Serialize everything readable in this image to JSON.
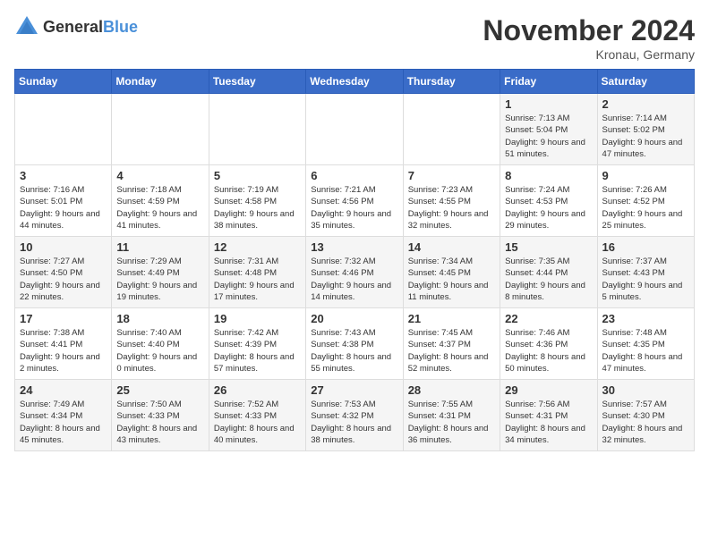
{
  "header": {
    "logo_general": "General",
    "logo_blue": "Blue",
    "month_title": "November 2024",
    "location": "Kronau, Germany"
  },
  "days_of_week": [
    "Sunday",
    "Monday",
    "Tuesday",
    "Wednesday",
    "Thursday",
    "Friday",
    "Saturday"
  ],
  "weeks": [
    [
      {
        "day": "",
        "info": ""
      },
      {
        "day": "",
        "info": ""
      },
      {
        "day": "",
        "info": ""
      },
      {
        "day": "",
        "info": ""
      },
      {
        "day": "",
        "info": ""
      },
      {
        "day": "1",
        "info": "Sunrise: 7:13 AM\nSunset: 5:04 PM\nDaylight: 9 hours and 51 minutes."
      },
      {
        "day": "2",
        "info": "Sunrise: 7:14 AM\nSunset: 5:02 PM\nDaylight: 9 hours and 47 minutes."
      }
    ],
    [
      {
        "day": "3",
        "info": "Sunrise: 7:16 AM\nSunset: 5:01 PM\nDaylight: 9 hours and 44 minutes."
      },
      {
        "day": "4",
        "info": "Sunrise: 7:18 AM\nSunset: 4:59 PM\nDaylight: 9 hours and 41 minutes."
      },
      {
        "day": "5",
        "info": "Sunrise: 7:19 AM\nSunset: 4:58 PM\nDaylight: 9 hours and 38 minutes."
      },
      {
        "day": "6",
        "info": "Sunrise: 7:21 AM\nSunset: 4:56 PM\nDaylight: 9 hours and 35 minutes."
      },
      {
        "day": "7",
        "info": "Sunrise: 7:23 AM\nSunset: 4:55 PM\nDaylight: 9 hours and 32 minutes."
      },
      {
        "day": "8",
        "info": "Sunrise: 7:24 AM\nSunset: 4:53 PM\nDaylight: 9 hours and 29 minutes."
      },
      {
        "day": "9",
        "info": "Sunrise: 7:26 AM\nSunset: 4:52 PM\nDaylight: 9 hours and 25 minutes."
      }
    ],
    [
      {
        "day": "10",
        "info": "Sunrise: 7:27 AM\nSunset: 4:50 PM\nDaylight: 9 hours and 22 minutes."
      },
      {
        "day": "11",
        "info": "Sunrise: 7:29 AM\nSunset: 4:49 PM\nDaylight: 9 hours and 19 minutes."
      },
      {
        "day": "12",
        "info": "Sunrise: 7:31 AM\nSunset: 4:48 PM\nDaylight: 9 hours and 17 minutes."
      },
      {
        "day": "13",
        "info": "Sunrise: 7:32 AM\nSunset: 4:46 PM\nDaylight: 9 hours and 14 minutes."
      },
      {
        "day": "14",
        "info": "Sunrise: 7:34 AM\nSunset: 4:45 PM\nDaylight: 9 hours and 11 minutes."
      },
      {
        "day": "15",
        "info": "Sunrise: 7:35 AM\nSunset: 4:44 PM\nDaylight: 9 hours and 8 minutes."
      },
      {
        "day": "16",
        "info": "Sunrise: 7:37 AM\nSunset: 4:43 PM\nDaylight: 9 hours and 5 minutes."
      }
    ],
    [
      {
        "day": "17",
        "info": "Sunrise: 7:38 AM\nSunset: 4:41 PM\nDaylight: 9 hours and 2 minutes."
      },
      {
        "day": "18",
        "info": "Sunrise: 7:40 AM\nSunset: 4:40 PM\nDaylight: 9 hours and 0 minutes."
      },
      {
        "day": "19",
        "info": "Sunrise: 7:42 AM\nSunset: 4:39 PM\nDaylight: 8 hours and 57 minutes."
      },
      {
        "day": "20",
        "info": "Sunrise: 7:43 AM\nSunset: 4:38 PM\nDaylight: 8 hours and 55 minutes."
      },
      {
        "day": "21",
        "info": "Sunrise: 7:45 AM\nSunset: 4:37 PM\nDaylight: 8 hours and 52 minutes."
      },
      {
        "day": "22",
        "info": "Sunrise: 7:46 AM\nSunset: 4:36 PM\nDaylight: 8 hours and 50 minutes."
      },
      {
        "day": "23",
        "info": "Sunrise: 7:48 AM\nSunset: 4:35 PM\nDaylight: 8 hours and 47 minutes."
      }
    ],
    [
      {
        "day": "24",
        "info": "Sunrise: 7:49 AM\nSunset: 4:34 PM\nDaylight: 8 hours and 45 minutes."
      },
      {
        "day": "25",
        "info": "Sunrise: 7:50 AM\nSunset: 4:33 PM\nDaylight: 8 hours and 43 minutes."
      },
      {
        "day": "26",
        "info": "Sunrise: 7:52 AM\nSunset: 4:33 PM\nDaylight: 8 hours and 40 minutes."
      },
      {
        "day": "27",
        "info": "Sunrise: 7:53 AM\nSunset: 4:32 PM\nDaylight: 8 hours and 38 minutes."
      },
      {
        "day": "28",
        "info": "Sunrise: 7:55 AM\nSunset: 4:31 PM\nDaylight: 8 hours and 36 minutes."
      },
      {
        "day": "29",
        "info": "Sunrise: 7:56 AM\nSunset: 4:31 PM\nDaylight: 8 hours and 34 minutes."
      },
      {
        "day": "30",
        "info": "Sunrise: 7:57 AM\nSunset: 4:30 PM\nDaylight: 8 hours and 32 minutes."
      }
    ]
  ]
}
